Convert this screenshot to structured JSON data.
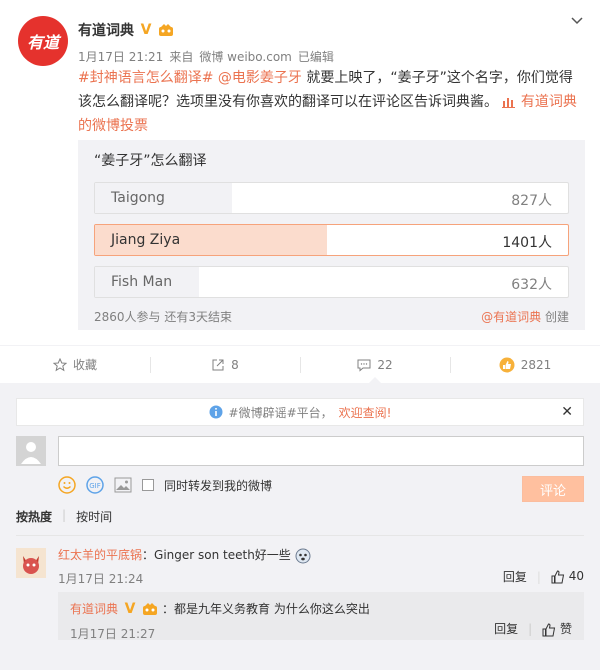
{
  "post": {
    "author": "有道词典",
    "avatar_text": "有道",
    "time": "1月17日 21:21",
    "source_prefix": "来自",
    "source": "微博 weibo.com",
    "edited": "已编辑",
    "text": {
      "hashtag": "#封神语言怎么翻译#",
      "mention": "@电影姜子牙",
      "body": " 就要上映了，“姜子牙”这个名字，你们觉得该怎么翻译呢？选项里没有你喜欢的翻译可以在评论区告诉词典酱。",
      "poll_link": "有道词典的微博投票"
    }
  },
  "poll": {
    "question": "“姜子牙”怎么翻译",
    "options": [
      {
        "label": "Taigong",
        "count": "827人",
        "fraction": 0.29,
        "selected": false
      },
      {
        "label": "Jiang Ziya",
        "count": "1401人",
        "fraction": 0.49,
        "selected": true
      },
      {
        "label": "Fish Man",
        "count": "632人",
        "fraction": 0.22,
        "selected": false
      }
    ],
    "participants": "2860人参与",
    "remaining": "还有3天结束",
    "creator": "@有道词典",
    "create_label": "创建"
  },
  "actions": {
    "favorite": "收藏",
    "repost": "8",
    "comment": "22",
    "like": "2821"
  },
  "comments": {
    "notice_tag": "#微博辟谣#平台，",
    "notice_link": "欢迎查阅!",
    "checkbox_label": "同时转发到我的微博",
    "submit": "评论",
    "sort_hot": "按热度",
    "sort_time": "按时间",
    "items": [
      {
        "name": "红太羊的平底锅",
        "text": "：Ginger son teeth好一些",
        "time": "1月17日 21:24",
        "reply_label": "回复",
        "likes": "40",
        "reply": {
          "name": "有道词典",
          "text": "：都是九年义务教育 为什么你这么突出",
          "time": "1月17日 21:27",
          "reply_label": "回复",
          "like_label": "赞"
        }
      }
    ]
  },
  "colors": {
    "accent": "#eb7350",
    "brand_red": "#e5322d",
    "selected_fill": "#fbdccd"
  }
}
